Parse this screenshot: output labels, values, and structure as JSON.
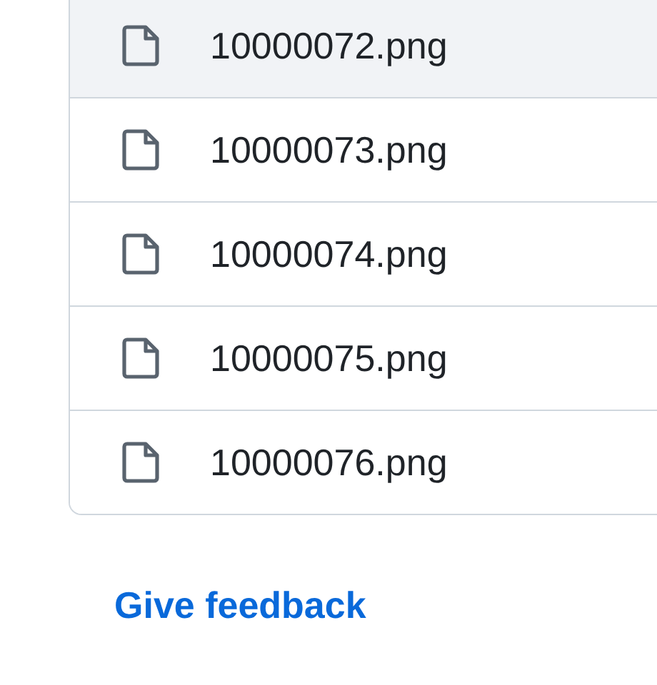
{
  "files": [
    {
      "name": "10000072.png",
      "highlighted": true
    },
    {
      "name": "10000073.png",
      "highlighted": false
    },
    {
      "name": "10000074.png",
      "highlighted": false
    },
    {
      "name": "10000075.png",
      "highlighted": false
    },
    {
      "name": "10000076.png",
      "highlighted": false
    }
  ],
  "feedback_link": "Give feedback"
}
